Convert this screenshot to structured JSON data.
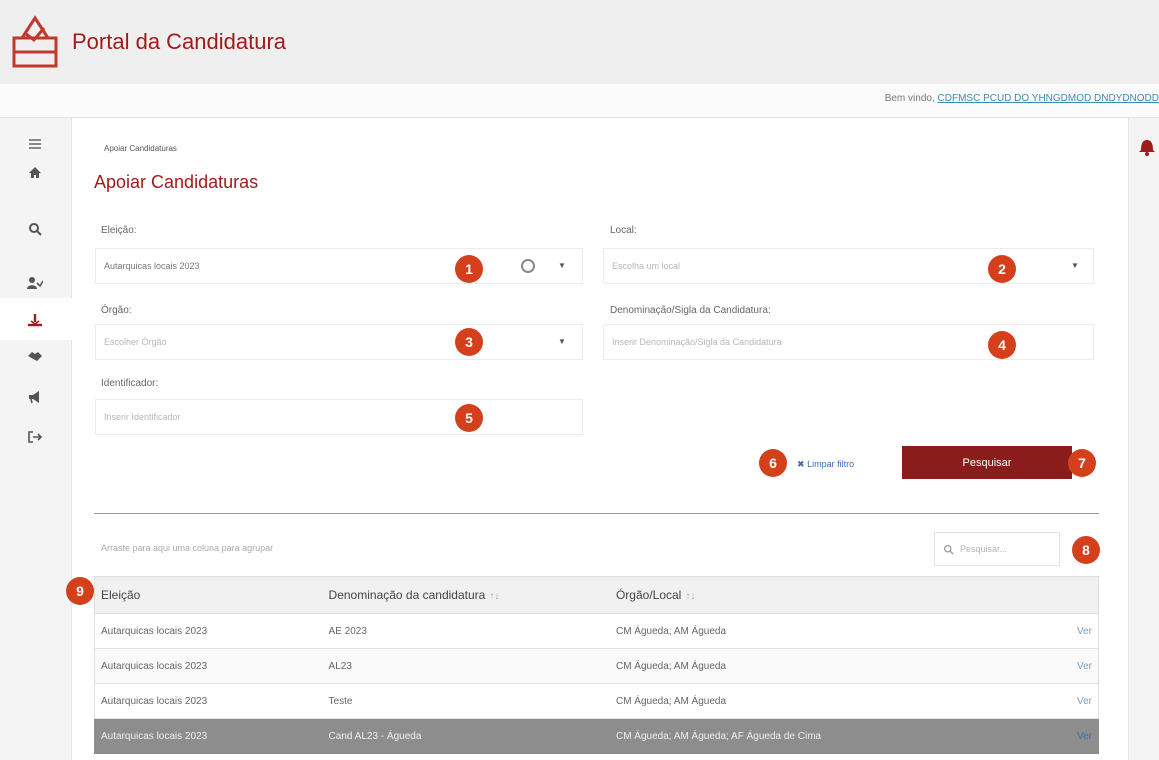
{
  "header": {
    "title": "Portal da Candidatura"
  },
  "welcome": {
    "prefix": "Bem vindo,",
    "user": "CDFMSC PCUD DO YHNGDMOD DNDYDNODD"
  },
  "sidebar": {
    "icons": [
      "menu-icon",
      "home-icon",
      "search-icon",
      "users-icon",
      "support-icon",
      "handshake-icon",
      "megaphone-icon",
      "logout-icon"
    ]
  },
  "breadcrumb": "Apoiar Candidaturas",
  "page_title": "Apoiar Candidaturas",
  "filters": {
    "eleicao": {
      "label": "Eleição:",
      "value": "Autarquicas locais 2023"
    },
    "local": {
      "label": "Local:",
      "placeholder": "Escolha um local"
    },
    "orgao": {
      "label": "Órgão:",
      "placeholder": "Escolher Órgão"
    },
    "denominacao": {
      "label": "Denominação/Sigla da Candidatura:",
      "placeholder": "Inserir Denominação/Sigla da Candidatura"
    },
    "identificador": {
      "label": "Identificador:",
      "placeholder": "Inserir Identificador"
    }
  },
  "actions": {
    "clear": "Limpar filtro",
    "search": "Pesquisar"
  },
  "markers": [
    "1",
    "2",
    "3",
    "4",
    "5",
    "6",
    "7",
    "8",
    "9"
  ],
  "grid": {
    "group_hint": "Arraste para aqui uma coluna para agrupar",
    "search_placeholder": "Pesquisar...",
    "columns": [
      "Eleição",
      "Denominação da candidatura",
      "Órgão/Local"
    ],
    "sort_icons": [
      "↑↓",
      "↑↓"
    ],
    "rows": [
      {
        "eleicao": "Autarquicas locais 2023",
        "denominacao": "AE 2023",
        "orgao": "CM Águeda; AM Águeda",
        "action": "Ver"
      },
      {
        "eleicao": "Autarquicas locais 2023",
        "denominacao": "AL23",
        "orgao": "CM Águeda; AM Águeda",
        "action": "Ver"
      },
      {
        "eleicao": "Autarquicas locais 2023",
        "denominacao": "Teste",
        "orgao": "CM Águeda; AM Águeda",
        "action": "Ver"
      },
      {
        "eleicao": "Autarquicas locais 2023",
        "denominacao": "Cand AL23 - Águeda",
        "orgao": "CM Águeda; AM Águeda; AF Águeda de Cima",
        "action": "Ver"
      }
    ]
  },
  "colors": {
    "brand": "#a01c1c",
    "marker": "#d5401c",
    "button": "#8b1c1c",
    "selected_row": "#8d8d8d"
  }
}
